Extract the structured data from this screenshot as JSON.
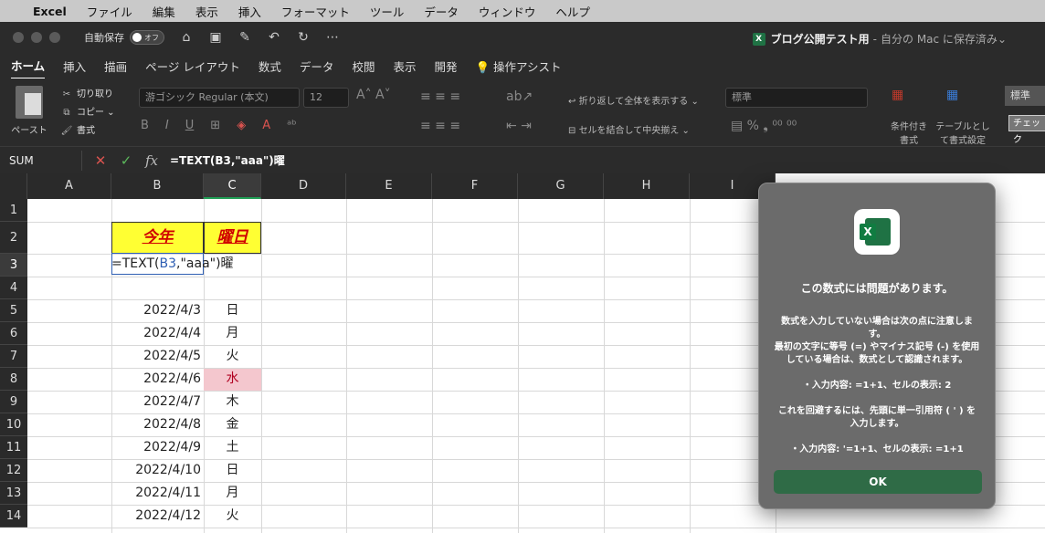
{
  "menubar": {
    "app_name": "Excel",
    "items": [
      "ファイル",
      "編集",
      "表示",
      "挿入",
      "フォーマット",
      "ツール",
      "データ",
      "ウィンドウ",
      "ヘルプ"
    ]
  },
  "titlebar": {
    "autosave_label": "自動保存",
    "autosave_state": "オフ",
    "doc_name": "ブログ公開テスト用",
    "doc_status": "自分の Mac に保存済み"
  },
  "ribbon_tabs": [
    "ホーム",
    "挿入",
    "描画",
    "ページ レイアウト",
    "数式",
    "データ",
    "校閲",
    "表示",
    "開発",
    "操作アシスト"
  ],
  "ribbon": {
    "paste": "ペースト",
    "cut": "切り取り",
    "copy": "コピー",
    "format_painter": "書式",
    "font_name": "游ゴシック Regular (本文)",
    "font_size": "12",
    "wrap_text": "折り返して全体を表示する",
    "merge_center": "セルを結合して中央揃え",
    "number_format": "標準",
    "conditional_format": "条件付き\n書式",
    "format_as_table": "テーブルとして書式設定",
    "style_standard": "標準",
    "style_check": "チェック"
  },
  "formula_bar": {
    "name_box": "SUM",
    "formula": "=TEXT(B3,\"aaa\")曜"
  },
  "grid": {
    "columns": [
      "A",
      "B",
      "C",
      "D",
      "E",
      "F",
      "G",
      "H",
      "I"
    ],
    "rows": [
      "1",
      "2",
      "3",
      "4",
      "5",
      "6",
      "7",
      "8",
      "9",
      "10",
      "11",
      "12",
      "13",
      "14"
    ],
    "header_b": "今年",
    "header_c": "曜日",
    "edit_prefix": "=TEXT(",
    "edit_ref": "B3",
    "edit_suffix": ",\"aaa\")曜",
    "dates": [
      "2022/4/3",
      "2022/4/4",
      "2022/4/5",
      "2022/4/6",
      "2022/4/7",
      "2022/4/8",
      "2022/4/9",
      "2022/4/10",
      "2022/4/11",
      "2022/4/12"
    ],
    "weekdays": [
      "日",
      "月",
      "火",
      "水",
      "木",
      "金",
      "土",
      "日",
      "月",
      "火"
    ]
  },
  "dialog": {
    "title": "この数式には問題があります。",
    "para1": "数式を入力していない場合は次の点に注意します。",
    "para2": "最初の文字に等号 (=) やマイナス記号 (-) を使用している場合は、数式として認識されます。",
    "example1": "・入力内容: =1+1、セルの表示: 2",
    "para3": "これを回避するには、先頭に単一引用符 ( ' ) を入力します。",
    "example2": "・入力内容: '=1+1、セルの表示: =1+1",
    "ok_label": "OK"
  }
}
